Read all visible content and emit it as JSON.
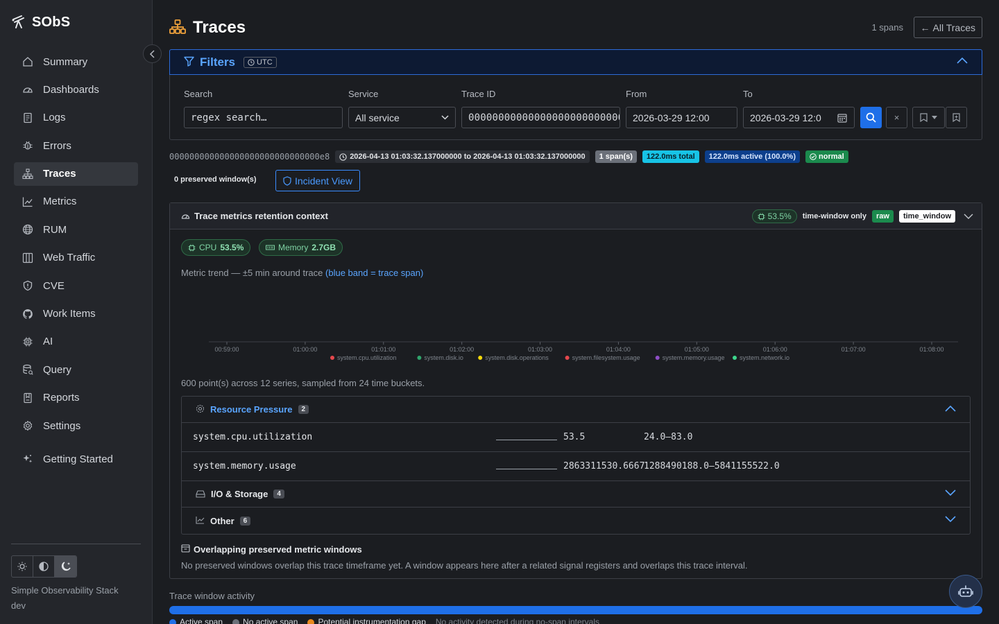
{
  "brand": {
    "name": "SObS",
    "tagline": "Simple Observability Stack",
    "env": "dev"
  },
  "sidebar": {
    "items": [
      {
        "label": "Summary",
        "icon": "home-icon"
      },
      {
        "label": "Dashboards",
        "icon": "gauge-icon"
      },
      {
        "label": "Logs",
        "icon": "document-icon"
      },
      {
        "label": "Errors",
        "icon": "bug-icon"
      },
      {
        "label": "Traces",
        "icon": "hierarchy-icon",
        "active": true
      },
      {
        "label": "Metrics",
        "icon": "chart-line-icon"
      },
      {
        "label": "RUM",
        "icon": "globe-icon"
      },
      {
        "label": "Web Traffic",
        "icon": "columns-icon"
      },
      {
        "label": "CVE",
        "icon": "shield-icon"
      },
      {
        "label": "Work Items",
        "icon": "github-icon"
      },
      {
        "label": "AI",
        "icon": "cpu-icon"
      },
      {
        "label": "Query",
        "icon": "database-icon"
      },
      {
        "label": "Reports",
        "icon": "bookmark-report-icon"
      },
      {
        "label": "Settings",
        "icon": "gear-icon"
      },
      {
        "label": "Getting Started",
        "icon": "sparkle-icon"
      }
    ]
  },
  "header": {
    "title": "Traces",
    "spans_count": "1 spans",
    "all_traces_label": "All Traces"
  },
  "filters": {
    "title": "Filters",
    "tz": "UTC",
    "search_label": "Search",
    "search_placeholder": "regex search…",
    "service_label": "Service",
    "service_value": "All service",
    "trace_id_label": "Trace ID",
    "trace_id_value": "000000000000000000000000000",
    "from_label": "From",
    "from_value": "2026-03-29 12:00",
    "to_label": "To",
    "to_value": "2026-03-29 12:0"
  },
  "trace": {
    "id": "000000000000000000000000000000e8",
    "range": "2026-04-13 01:03:32.137000000 to 2026-04-13 01:03:32.137000000",
    "span_count": "1 span(s)",
    "total": "122.0ms total",
    "active": "122.0ms active (100.0%)",
    "status": "normal",
    "preserved": "0 preserved window(s)",
    "incident_label": "Incident View"
  },
  "retention": {
    "title": "Trace metrics retention context",
    "pct": "53.5%",
    "mode": "time-window only",
    "raw": "raw",
    "window": "time_window",
    "cpu_label": "CPU",
    "cpu_value": "53.5%",
    "mem_label": "Memory",
    "mem_value": "2.7GB",
    "trend_note": "Metric trend — ±5 min around trace",
    "trend_band": "(blue band = trace span)",
    "points_note": "600 point(s) across 12 series, sampled from 24 time buckets."
  },
  "chart_data": {
    "type": "line",
    "x": [
      "00:59:00",
      "01:00:00",
      "01:01:00",
      "01:02:00",
      "01:03:00",
      "01:04:00",
      "01:05:00",
      "01:06:00",
      "01:07:00",
      "01:08:00"
    ],
    "series": [
      {
        "name": "system.cpu.utilization",
        "color": "#e5484d"
      },
      {
        "name": "system.disk.io",
        "color": "#30a46c"
      },
      {
        "name": "system.disk.operations",
        "color": "#f5d90a"
      },
      {
        "name": "system.filesystem.usage",
        "color": "#e5484d"
      },
      {
        "name": "system.memory.usage",
        "color": "#8e4ec6"
      },
      {
        "name": "system.network.io",
        "color": "#3dd68c"
      }
    ]
  },
  "groups": [
    {
      "title": "Resource Pressure",
      "count": "2",
      "expanded": true,
      "rows": [
        {
          "name": "system.cpu.utilization",
          "value": "53.5",
          "range": "24.0–83.0"
        },
        {
          "name": "system.memory.usage",
          "value": "2863311530.6667",
          "range": "1288490188.0–5841155522.0"
        }
      ]
    },
    {
      "title": "I/O & Storage",
      "count": "4",
      "expanded": false
    },
    {
      "title": "Other",
      "count": "6",
      "expanded": false
    }
  ],
  "overlap": {
    "title": "Overlapping preserved metric windows",
    "note": "No preserved windows overlap this trace timeframe yet. A window appears here after a related signal registers and overlaps this trace interval."
  },
  "activity": {
    "label": "Trace window activity",
    "legend": [
      {
        "label": "Active span",
        "color": "#1f6fe8"
      },
      {
        "label": "No active span",
        "color": "#6b7079"
      },
      {
        "label": "Potential instrumentation gap",
        "color": "#e8891f"
      }
    ],
    "note": "No activity detected during no-span intervals"
  }
}
